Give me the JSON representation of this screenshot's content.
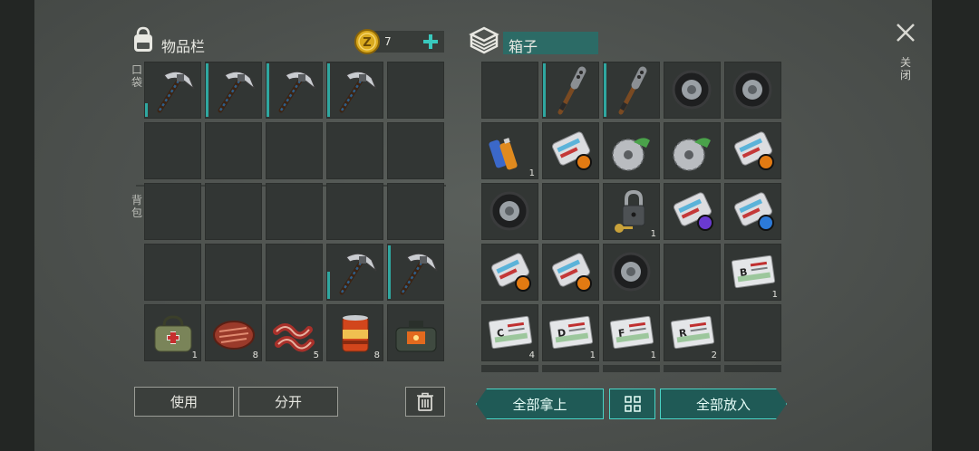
{
  "inventory": {
    "title": "物品栏",
    "coins": "7",
    "pocket_label": "口袋",
    "backpack_label": "背包"
  },
  "chest": {
    "title": "箱子"
  },
  "close": {
    "label": "关闭"
  },
  "buttons": {
    "use": "使用",
    "split": "分开",
    "take_all": "全部拿上",
    "put_all": "全部放入"
  },
  "colors": {
    "accent": "#3fd1c3",
    "slot": "#323634",
    "panel": "#4f5350"
  },
  "inventory_items": [
    {
      "id": "pickaxe",
      "durability": 0.25,
      "count": ""
    },
    {
      "id": "pickaxe",
      "durability": 1.0,
      "count": ""
    },
    {
      "id": "pickaxe",
      "durability": 1.0,
      "count": ""
    },
    {
      "id": "pickaxe",
      "durability": 1.0,
      "count": ""
    },
    {
      "id": "empty",
      "count": ""
    },
    {
      "id": "empty",
      "count": ""
    },
    {
      "id": "empty",
      "count": ""
    },
    {
      "id": "empty",
      "count": ""
    },
    {
      "id": "empty",
      "count": ""
    },
    {
      "id": "empty",
      "count": ""
    },
    {
      "id": "empty",
      "count": ""
    },
    {
      "id": "empty",
      "count": ""
    },
    {
      "id": "empty",
      "count": ""
    },
    {
      "id": "empty",
      "count": ""
    },
    {
      "id": "empty",
      "count": ""
    },
    {
      "id": "empty",
      "count": ""
    },
    {
      "id": "empty",
      "count": ""
    },
    {
      "id": "empty",
      "count": ""
    },
    {
      "id": "pickaxe",
      "durability": 0.5,
      "count": ""
    },
    {
      "id": "pickaxe",
      "durability": 1.0,
      "count": ""
    },
    {
      "id": "medkit-bag",
      "count": "1"
    },
    {
      "id": "steak",
      "count": "8"
    },
    {
      "id": "bacon",
      "count": "5"
    },
    {
      "id": "canned-food",
      "count": "8"
    },
    {
      "id": "supply-bag",
      "count": ""
    }
  ],
  "chest_items": [
    {
      "id": "empty",
      "count": ""
    },
    {
      "id": "bat",
      "durability": 1.0,
      "count": ""
    },
    {
      "id": "bat",
      "durability": 1.0,
      "count": ""
    },
    {
      "id": "tire",
      "count": ""
    },
    {
      "id": "tire",
      "count": ""
    },
    {
      "id": "batteries",
      "count": "1"
    },
    {
      "id": "magazine",
      "badge": "orange",
      "count": ""
    },
    {
      "id": "saw-blade",
      "count": ""
    },
    {
      "id": "saw-blade",
      "count": ""
    },
    {
      "id": "magazine",
      "badge": "orange",
      "count": ""
    },
    {
      "id": "tire",
      "count": ""
    },
    {
      "id": "empty",
      "count": ""
    },
    {
      "id": "padlock",
      "count": "1"
    },
    {
      "id": "magazine",
      "badge": "purple",
      "count": ""
    },
    {
      "id": "magazine",
      "badge": "blue",
      "count": ""
    },
    {
      "id": "magazine",
      "badge": "orange",
      "count": ""
    },
    {
      "id": "magazine",
      "badge": "orange",
      "count": ""
    },
    {
      "id": "tire",
      "count": ""
    },
    {
      "id": "empty",
      "count": ""
    },
    {
      "id": "card",
      "letter": "B",
      "count": "1"
    },
    {
      "id": "card",
      "letter": "C",
      "count": "4"
    },
    {
      "id": "card",
      "letter": "D",
      "count": "1"
    },
    {
      "id": "card",
      "letter": "F",
      "count": "1"
    },
    {
      "id": "card",
      "letter": "R",
      "count": "2"
    },
    {
      "id": "empty",
      "count": ""
    }
  ]
}
